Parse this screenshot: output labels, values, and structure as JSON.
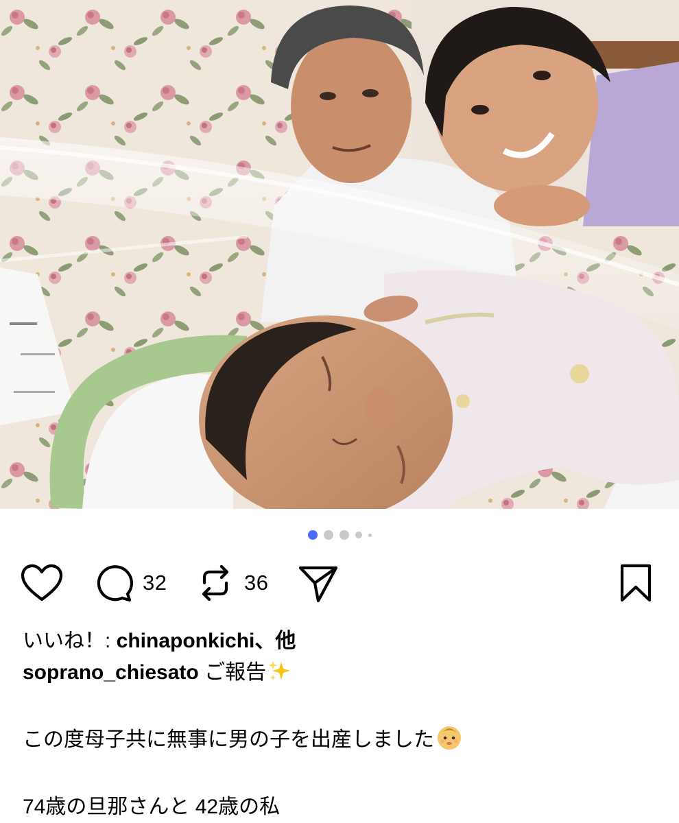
{
  "post": {
    "photo": {
      "alt": "",
      "carousel": {
        "total": 5,
        "active_index": 0,
        "active_color": "#4f6bff",
        "inactive_color": "#c9c9c9"
      }
    },
    "actions": {
      "like_icon": "heart-outline-icon",
      "comment_icon": "speech-bubble-icon",
      "comment_count": "32",
      "repost_icon": "repost-arrows-icon",
      "repost_count": "36",
      "share_icon": "paper-plane-icon",
      "save_icon": "bookmark-outline-icon"
    },
    "likes": {
      "prefix": "いいね！: ",
      "user": "chinaponkichi",
      "suffix": "、他"
    },
    "caption": {
      "author": "soprano_chiesato",
      "headline": " ご報告",
      "headline_emoji": "sparkles-emoji",
      "line1": "この度母子共に無事に男の子を出産しました",
      "line1_emoji": "baby-emoji",
      "line2": "74歳の旦那さんと 42歳の私"
    }
  }
}
